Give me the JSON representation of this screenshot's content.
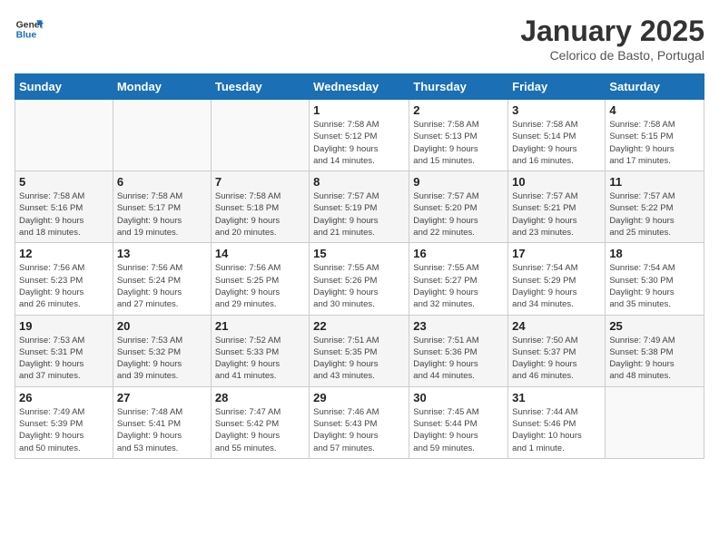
{
  "logo": {
    "line1": "General",
    "line2": "Blue"
  },
  "title": "January 2025",
  "subtitle": "Celorico de Basto, Portugal",
  "weekdays": [
    "Sunday",
    "Monday",
    "Tuesday",
    "Wednesday",
    "Thursday",
    "Friday",
    "Saturday"
  ],
  "weeks": [
    [
      {
        "day": "",
        "info": ""
      },
      {
        "day": "",
        "info": ""
      },
      {
        "day": "",
        "info": ""
      },
      {
        "day": "1",
        "info": "Sunrise: 7:58 AM\nSunset: 5:12 PM\nDaylight: 9 hours\nand 14 minutes."
      },
      {
        "day": "2",
        "info": "Sunrise: 7:58 AM\nSunset: 5:13 PM\nDaylight: 9 hours\nand 15 minutes."
      },
      {
        "day": "3",
        "info": "Sunrise: 7:58 AM\nSunset: 5:14 PM\nDaylight: 9 hours\nand 16 minutes."
      },
      {
        "day": "4",
        "info": "Sunrise: 7:58 AM\nSunset: 5:15 PM\nDaylight: 9 hours\nand 17 minutes."
      }
    ],
    [
      {
        "day": "5",
        "info": "Sunrise: 7:58 AM\nSunset: 5:16 PM\nDaylight: 9 hours\nand 18 minutes."
      },
      {
        "day": "6",
        "info": "Sunrise: 7:58 AM\nSunset: 5:17 PM\nDaylight: 9 hours\nand 19 minutes."
      },
      {
        "day": "7",
        "info": "Sunrise: 7:58 AM\nSunset: 5:18 PM\nDaylight: 9 hours\nand 20 minutes."
      },
      {
        "day": "8",
        "info": "Sunrise: 7:57 AM\nSunset: 5:19 PM\nDaylight: 9 hours\nand 21 minutes."
      },
      {
        "day": "9",
        "info": "Sunrise: 7:57 AM\nSunset: 5:20 PM\nDaylight: 9 hours\nand 22 minutes."
      },
      {
        "day": "10",
        "info": "Sunrise: 7:57 AM\nSunset: 5:21 PM\nDaylight: 9 hours\nand 23 minutes."
      },
      {
        "day": "11",
        "info": "Sunrise: 7:57 AM\nSunset: 5:22 PM\nDaylight: 9 hours\nand 25 minutes."
      }
    ],
    [
      {
        "day": "12",
        "info": "Sunrise: 7:56 AM\nSunset: 5:23 PM\nDaylight: 9 hours\nand 26 minutes."
      },
      {
        "day": "13",
        "info": "Sunrise: 7:56 AM\nSunset: 5:24 PM\nDaylight: 9 hours\nand 27 minutes."
      },
      {
        "day": "14",
        "info": "Sunrise: 7:56 AM\nSunset: 5:25 PM\nDaylight: 9 hours\nand 29 minutes."
      },
      {
        "day": "15",
        "info": "Sunrise: 7:55 AM\nSunset: 5:26 PM\nDaylight: 9 hours\nand 30 minutes."
      },
      {
        "day": "16",
        "info": "Sunrise: 7:55 AM\nSunset: 5:27 PM\nDaylight: 9 hours\nand 32 minutes."
      },
      {
        "day": "17",
        "info": "Sunrise: 7:54 AM\nSunset: 5:29 PM\nDaylight: 9 hours\nand 34 minutes."
      },
      {
        "day": "18",
        "info": "Sunrise: 7:54 AM\nSunset: 5:30 PM\nDaylight: 9 hours\nand 35 minutes."
      }
    ],
    [
      {
        "day": "19",
        "info": "Sunrise: 7:53 AM\nSunset: 5:31 PM\nDaylight: 9 hours\nand 37 minutes."
      },
      {
        "day": "20",
        "info": "Sunrise: 7:53 AM\nSunset: 5:32 PM\nDaylight: 9 hours\nand 39 minutes."
      },
      {
        "day": "21",
        "info": "Sunrise: 7:52 AM\nSunset: 5:33 PM\nDaylight: 9 hours\nand 41 minutes."
      },
      {
        "day": "22",
        "info": "Sunrise: 7:51 AM\nSunset: 5:35 PM\nDaylight: 9 hours\nand 43 minutes."
      },
      {
        "day": "23",
        "info": "Sunrise: 7:51 AM\nSunset: 5:36 PM\nDaylight: 9 hours\nand 44 minutes."
      },
      {
        "day": "24",
        "info": "Sunrise: 7:50 AM\nSunset: 5:37 PM\nDaylight: 9 hours\nand 46 minutes."
      },
      {
        "day": "25",
        "info": "Sunrise: 7:49 AM\nSunset: 5:38 PM\nDaylight: 9 hours\nand 48 minutes."
      }
    ],
    [
      {
        "day": "26",
        "info": "Sunrise: 7:49 AM\nSunset: 5:39 PM\nDaylight: 9 hours\nand 50 minutes."
      },
      {
        "day": "27",
        "info": "Sunrise: 7:48 AM\nSunset: 5:41 PM\nDaylight: 9 hours\nand 53 minutes."
      },
      {
        "day": "28",
        "info": "Sunrise: 7:47 AM\nSunset: 5:42 PM\nDaylight: 9 hours\nand 55 minutes."
      },
      {
        "day": "29",
        "info": "Sunrise: 7:46 AM\nSunset: 5:43 PM\nDaylight: 9 hours\nand 57 minutes."
      },
      {
        "day": "30",
        "info": "Sunrise: 7:45 AM\nSunset: 5:44 PM\nDaylight: 9 hours\nand 59 minutes."
      },
      {
        "day": "31",
        "info": "Sunrise: 7:44 AM\nSunset: 5:46 PM\nDaylight: 10 hours\nand 1 minute."
      },
      {
        "day": "",
        "info": ""
      }
    ]
  ]
}
